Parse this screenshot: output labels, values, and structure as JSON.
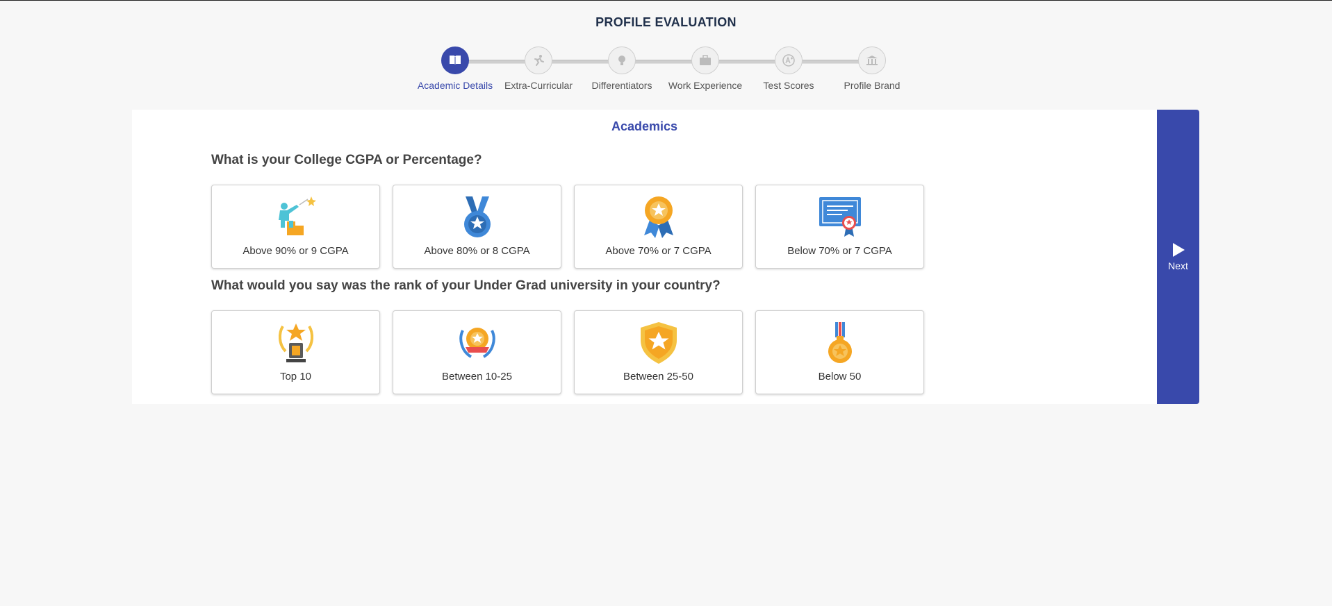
{
  "page": {
    "title": "PROFILE EVALUATION"
  },
  "stepper": {
    "steps": [
      {
        "label": "Academic Details",
        "icon": "book-icon",
        "active": true
      },
      {
        "label": "Extra-Curricular",
        "icon": "runner-icon",
        "active": false
      },
      {
        "label": "Differentiators",
        "icon": "lightbulb-icon",
        "active": false
      },
      {
        "label": "Work Experience",
        "icon": "briefcase-icon",
        "active": false
      },
      {
        "label": "Test Scores",
        "icon": "a-plus-icon",
        "active": false
      },
      {
        "label": "Profile Brand",
        "icon": "institution-icon",
        "active": false
      }
    ]
  },
  "section": {
    "title": "Academics"
  },
  "questions": [
    {
      "text": "What is your College CGPA or Percentage?",
      "options": [
        {
          "label": "Above 90% or 9 CGPA",
          "icon": "achiever-icon"
        },
        {
          "label": "Above 80% or 8 CGPA",
          "icon": "medal-icon"
        },
        {
          "label": "Above 70% or 7 CGPA",
          "icon": "award-rosette-icon"
        },
        {
          "label": "Below 70% or 7 CGPA",
          "icon": "certificate-icon"
        }
      ]
    },
    {
      "text": "What would you say was the rank of your Under Grad university in your country?",
      "options": [
        {
          "label": "Top 10",
          "icon": "trophy-laurel-icon"
        },
        {
          "label": "Between 10-25",
          "icon": "laurel-badge-icon"
        },
        {
          "label": "Between 25-50",
          "icon": "shield-star-icon"
        },
        {
          "label": "Below 50",
          "icon": "gold-medal-icon"
        }
      ]
    }
  ],
  "next": {
    "label": "Next",
    "icon": "play-icon"
  },
  "colors": {
    "accent": "#3949ab",
    "background": "#f7f7f7",
    "panel": "#ffffff"
  }
}
